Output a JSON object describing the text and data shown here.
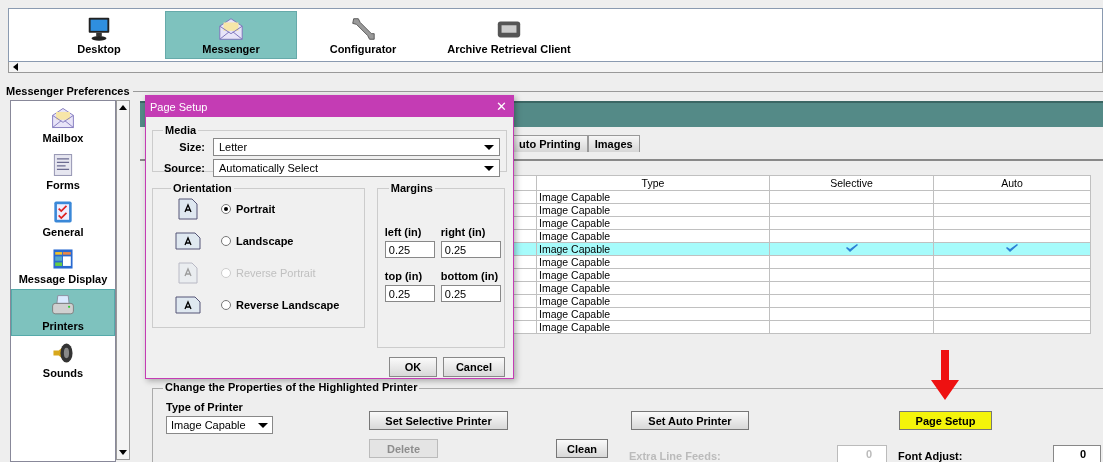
{
  "app_tabs": [
    {
      "label": "Desktop",
      "selected": false
    },
    {
      "label": "Messenger",
      "selected": true
    },
    {
      "label": "Configurator",
      "selected": false
    },
    {
      "label": "Archive Retrieval Client",
      "selected": false
    }
  ],
  "section_title": "Messenger Preferences",
  "sidebar": {
    "items": [
      {
        "label": "Mailbox",
        "selected": false
      },
      {
        "label": "Forms",
        "selected": false
      },
      {
        "label": "General",
        "selected": false
      },
      {
        "label": "Message Display",
        "selected": false
      },
      {
        "label": "Printers",
        "selected": true
      },
      {
        "label": "Sounds",
        "selected": false
      }
    ]
  },
  "tabs": [
    {
      "label": "uto Printing",
      "selected": false
    },
    {
      "label": "Images",
      "selected": false
    }
  ],
  "table": {
    "columns": [
      "Type",
      "Selective",
      "Auto"
    ],
    "rows": [
      {
        "type": "Image Capable",
        "selective": false,
        "auto": false,
        "selected": false
      },
      {
        "type": "Image Capable",
        "selective": false,
        "auto": false,
        "selected": false
      },
      {
        "type": "Image Capable",
        "selective": false,
        "auto": false,
        "selected": false
      },
      {
        "type": "Image Capable",
        "selective": false,
        "auto": false,
        "selected": false
      },
      {
        "type": "Image Capable",
        "selective": true,
        "auto": true,
        "selected": true
      },
      {
        "type": "Image Capable",
        "selective": false,
        "auto": false,
        "selected": false
      },
      {
        "type": "Image Capable",
        "selective": false,
        "auto": false,
        "selected": false
      },
      {
        "type": "Image Capable",
        "selective": false,
        "auto": false,
        "selected": false
      },
      {
        "type": "Image Capable",
        "selective": false,
        "auto": false,
        "selected": false
      },
      {
        "type": "Image Capable",
        "selective": false,
        "auto": false,
        "selected": false
      },
      {
        "type": "Image Capable",
        "selective": false,
        "auto": false,
        "selected": false
      }
    ]
  },
  "properties": {
    "title": "Change the Properties of the Highlighted Printer",
    "type_label": "Type of Printer",
    "type_value": "Image Capable",
    "buttons": [
      {
        "label": "Set Selective Printer",
        "highlighted": false
      },
      {
        "label": "Set Auto Printer",
        "highlighted": false
      },
      {
        "label": "Page Setup",
        "highlighted": true
      }
    ],
    "delete": {
      "label": "Delete",
      "disabled": true
    },
    "clean": {
      "label": "Clean",
      "disabled": false
    },
    "extra_line_feeds": {
      "label": "Extra Line Feeds:",
      "value": "0",
      "disabled": true
    },
    "font_adjust": {
      "label": "Font Adjust:",
      "value": "0",
      "disabled": false
    }
  },
  "dialog": {
    "title": "Page Setup",
    "close": "✕",
    "media": {
      "title": "Media",
      "size_label": "Size:",
      "size": "Letter",
      "source_label": "Source:",
      "source": "Automatically Select"
    },
    "orientation": {
      "title": "Orientation",
      "options": [
        {
          "label": "Portrait",
          "selected": true,
          "disabled": false
        },
        {
          "label": "Landscape",
          "selected": false,
          "disabled": false
        },
        {
          "label": "Reverse Portrait",
          "selected": false,
          "disabled": true
        },
        {
          "label": "Reverse Landscape",
          "selected": false,
          "disabled": false
        }
      ]
    },
    "margins": {
      "title": "Margins",
      "fields": [
        {
          "label": "left (in)",
          "value": "0.25"
        },
        {
          "label": "right (in)",
          "value": "0.25"
        },
        {
          "label": "top (in)",
          "value": "0.25"
        },
        {
          "label": "bottom (in)",
          "value": "0.25"
        }
      ]
    },
    "buttons": [
      "OK",
      "Cancel"
    ]
  }
}
